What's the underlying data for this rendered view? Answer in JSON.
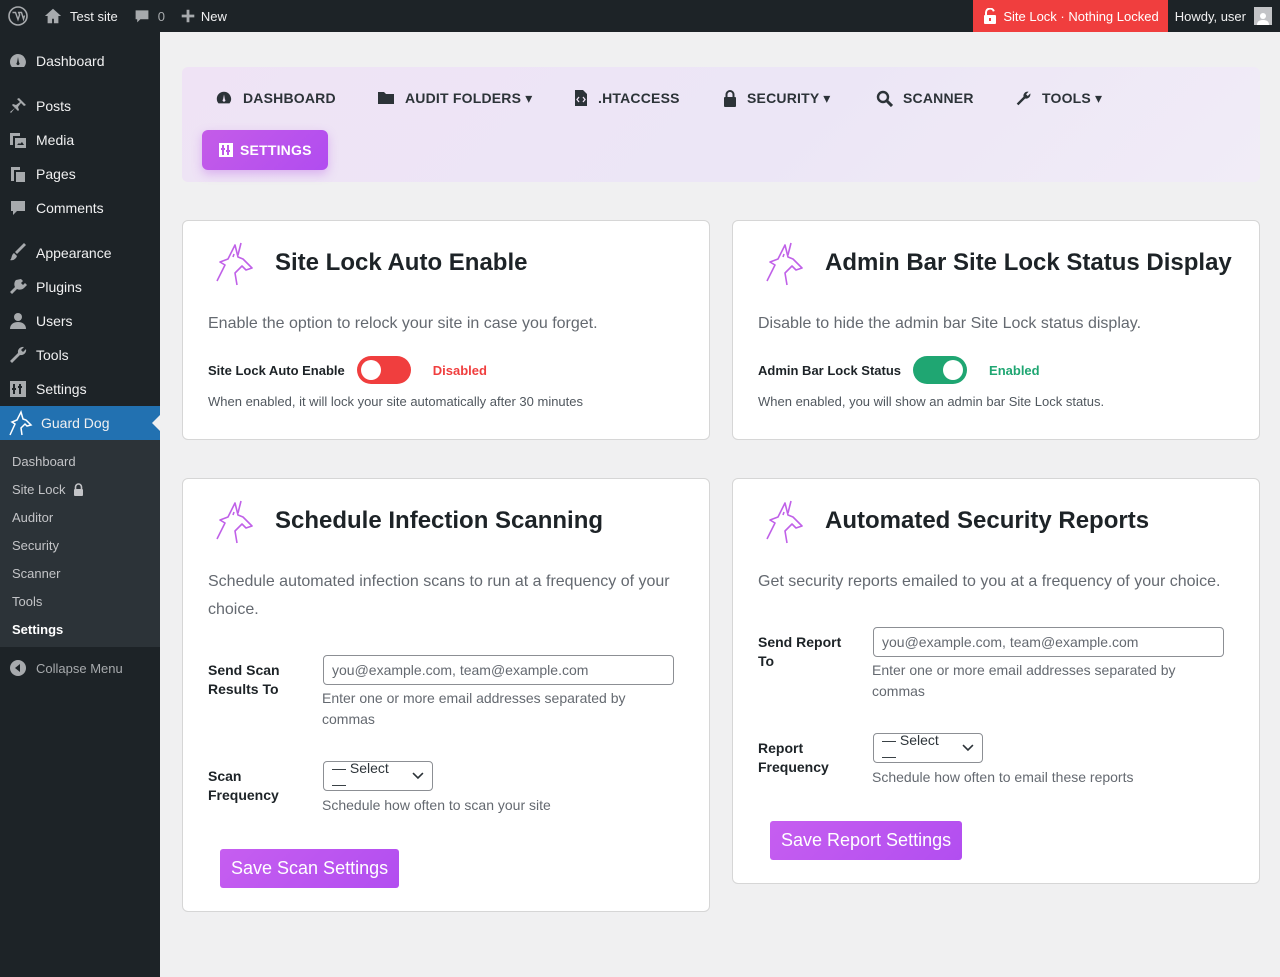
{
  "adminbar": {
    "site_name": "Test site",
    "comments_count": "0",
    "new_label": "New",
    "site_lock_status": "Site Lock · Nothing Locked",
    "howdy": "Howdy, user"
  },
  "sidebar": {
    "items": [
      {
        "label": "Dashboard",
        "icon": "dashboard-icon"
      },
      {
        "label": "Posts",
        "icon": "pin-icon"
      },
      {
        "label": "Media",
        "icon": "media-icon"
      },
      {
        "label": "Pages",
        "icon": "pages-icon"
      },
      {
        "label": "Comments",
        "icon": "comment-icon"
      },
      {
        "label": "Appearance",
        "icon": "brush-icon"
      },
      {
        "label": "Plugins",
        "icon": "plugin-icon"
      },
      {
        "label": "Users",
        "icon": "user-icon"
      },
      {
        "label": "Tools",
        "icon": "wrench-icon"
      },
      {
        "label": "Settings",
        "icon": "sliders-icon"
      },
      {
        "label": "Guard Dog",
        "icon": "guard-dog-icon"
      }
    ],
    "submenu": [
      "Dashboard",
      "Site Lock",
      "Auditor",
      "Security",
      "Scanner",
      "Tools",
      "Settings"
    ],
    "collapse_label": "Collapse Menu"
  },
  "nav": {
    "tabs": [
      "DASHBOARD",
      "AUDIT FOLDERS ▾",
      ".HTACCESS",
      "SECURITY ▾",
      "SCANNER",
      "TOOLS ▾",
      "SETTINGS"
    ]
  },
  "cards": {
    "auto_enable": {
      "title": "Site Lock Auto Enable",
      "desc": "Enable the option to relock your site in case you forget.",
      "toggle_label": "Site Lock Auto Enable",
      "state": "Disabled",
      "hint": "When enabled, it will lock your site automatically after 30 minutes"
    },
    "admin_bar": {
      "title": "Admin Bar Site Lock Status Display",
      "desc": "Disable to hide the admin bar Site Lock status display.",
      "toggle_label": "Admin Bar Lock Status",
      "state": "Enabled",
      "hint": "When enabled, you will show an admin bar Site Lock status."
    },
    "scan": {
      "title": "Schedule Infection Scanning",
      "desc_line1": "Schedule automated infection scans to run at a frequency of your",
      "desc_line2": "choice.",
      "send_label_line1": "Send Scan",
      "send_label_line2": "Results To",
      "email_placeholder": "you@example.com, team@example.com",
      "email_hint_line1": "Enter one or more email addresses separated by",
      "email_hint_line2": "commas",
      "freq_label_line1": "Scan",
      "freq_label_line2": "Frequency",
      "freq_value": "— Select —",
      "freq_hint": "Schedule how often to scan your site",
      "save_label": "Save Scan Settings"
    },
    "reports": {
      "title": "Automated Security Reports",
      "desc": "Get security reports emailed to you at a frequency of your choice.",
      "send_label_line1": "Send Report",
      "send_label_line2": "To",
      "email_placeholder": "you@example.com, team@example.com",
      "email_hint_line1": "Enter one or more email addresses separated by",
      "email_hint_line2": "commas",
      "freq_label_line1": "Report",
      "freq_label_line2": "Frequency",
      "freq_value": "— Select —",
      "freq_hint": "Schedule how often to email these reports",
      "save_label": "Save Report Settings"
    }
  },
  "colors": {
    "accent": "#b853f0",
    "disabled": "#f03e3e",
    "enabled": "#1fa672",
    "wp_blue": "#2271b1"
  }
}
